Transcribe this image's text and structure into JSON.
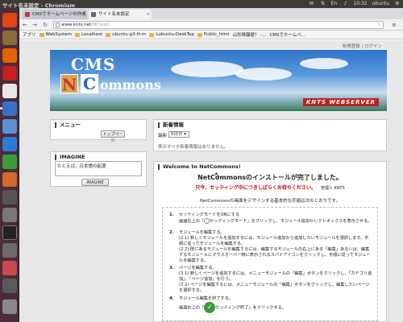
{
  "topbar": {
    "title": "サイト名未設定 - Chromium",
    "time": "10:32",
    "user": "ubuntu"
  },
  "tabs": [
    {
      "label": "CMSでホームページの作成",
      "close": "×"
    },
    {
      "label": "サイト名未設定",
      "close": "×"
    }
  ],
  "url": {
    "host": "www.knts.net",
    "path": "/NCtest/"
  },
  "bookmarks": [
    "アプリ",
    "WebSystem",
    "Localhost",
    "ubuntu-g3-tt-m",
    "Lubuntu-DeskTop",
    "Public_html",
    "山形情報便！ -...",
    "CMSでホームペ..."
  ],
  "header_links": {
    "register": "新規登録",
    "login": "ログイン"
  },
  "banner": {
    "brand": "KNTS WEBSERVER"
  },
  "menu_panel": {
    "title": "メニュー",
    "top_page_button": "トップページ"
  },
  "imagine_panel": {
    "title": "IMAGINE",
    "textarea_value": "たとえば、日本語の起源",
    "button": "IMAGINE"
  },
  "news_panel": {
    "title": "新着情報",
    "recent_label": "最新",
    "recent_value": "5日分",
    "no_items": "表示すべき新着情報はありません。"
  },
  "welcome_panel": {
    "title": "Welcome to NetCommons!",
    "headline": "NetCommonsのインストールが完了しました。",
    "notice": "只今、セッティング中につきしばらくお待ちください。",
    "admin": "管理人 KNTS",
    "intro": "NetCommonsの画面をデザインする基本的な手順は次のとおりです。",
    "steps": [
      {
        "num": "1.",
        "lines": [
          "セッティングモードをONにする",
          "画面右上の「",
          "セッティングモード」をクリックし、モジュール追加セレクトボックスを表示させる。"
        ]
      },
      {
        "num": "2.",
        "lines": [
          "モジュールを編集する。",
          "(2.1) 新しくモジュールを追加するには、モジュール追加から追加したいモジュールを選択します。手順に従ってモジュールを編集する。",
          "(2.2) 既にあるモジュールを編集するには、編集するモジュールの右上にある「編集」あるいは、編集するモジュールにマウスオーバー時に表示されるスパナアイコンをクリックし、手順に従ってモジュールを編集する。"
        ]
      },
      {
        "num": "3.",
        "lines": [
          "ページを編集する。",
          "(3.1) 新しくページを追加するには、メニューモジュールの「編集」ボタンをクリックし、「カテゴリ追加」、「ページ追加」を行う。",
          "(3.2) ページを編集するには、メニューモジュールの「編集」ボタンをクリックし、編集したいページを選択する。"
        ]
      },
      {
        "num": "4.",
        "lines": [
          "モジュール編集を終了する。",
          "画面右上の「",
          "セッティング終了」をクリックする。"
        ]
      }
    ]
  }
}
